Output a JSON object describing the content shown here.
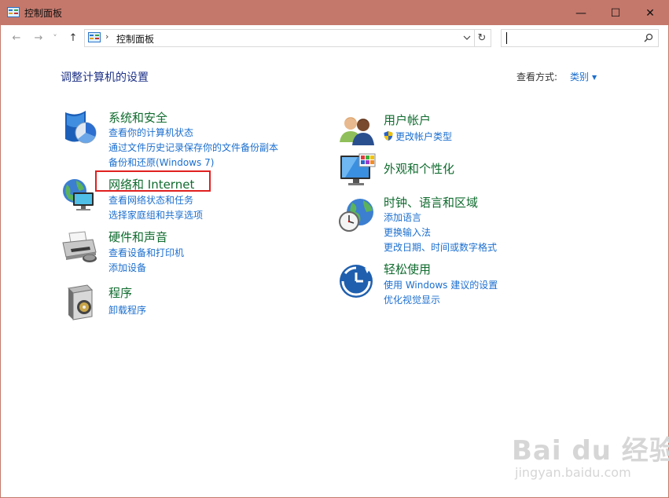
{
  "window": {
    "title": "控制面板",
    "controls": {
      "minimize": "—",
      "maximize": "☐",
      "close": "✕"
    }
  },
  "nav": {
    "back": "←",
    "forward": "→",
    "recent": "˅",
    "up": "↑",
    "address_sep": "›",
    "address": "控制面板",
    "refresh": "↻"
  },
  "search": {
    "value": "",
    "placeholder": ""
  },
  "page": {
    "heading": "调整计算机的设置",
    "view_by_label": "查看方式:",
    "view_by_value": "类别"
  },
  "categories_left": [
    {
      "title": "系统和安全",
      "icon": "shield-icon",
      "links": [
        "查看你的计算机状态",
        "通过文件历史记录保存你的文件备份副本",
        "备份和还原(Windows 7)"
      ]
    },
    {
      "title": "网络和 Internet",
      "icon": "network-globe-icon",
      "links": [
        "查看网络状态和任务",
        "选择家庭组和共享选项"
      ]
    },
    {
      "title": "硬件和声音",
      "icon": "printer-icon",
      "links": [
        "查看设备和打印机",
        "添加设备"
      ]
    },
    {
      "title": "程序",
      "icon": "programs-box-icon",
      "links": [
        "卸载程序"
      ]
    }
  ],
  "categories_right": [
    {
      "title": "用户帐户",
      "icon": "users-icon",
      "links": [
        "更改帐户类型"
      ]
    },
    {
      "title": "外观和个性化",
      "icon": "monitor-icon",
      "links": []
    },
    {
      "title": "时钟、语言和区域",
      "icon": "clock-globe-icon",
      "links": [
        "添加语言",
        "更换输入法",
        "更改日期、时间或数字格式"
      ]
    },
    {
      "title": "轻松使用",
      "icon": "ease-of-access-icon",
      "links": [
        "使用 Windows 建议的设置",
        "优化视觉显示"
      ]
    }
  ],
  "watermark": {
    "line1": "Bai du 经验",
    "line2": "jingyan.baidu.com"
  },
  "colors": {
    "titlebar": "#c4786b",
    "category_title": "#0f6b2e",
    "link": "#1c6fcf",
    "heading": "#1e3287",
    "highlight": "#e02020"
  }
}
